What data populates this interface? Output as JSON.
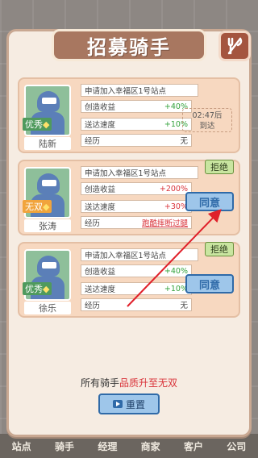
{
  "bottom_nav": [
    "站点",
    "骑手",
    "经理",
    "商家",
    "客户",
    "公司"
  ],
  "title": "招募骑手",
  "close_icon": "fork-knife-icon",
  "labels": {
    "profit": "创造收益",
    "speed": "送达速度",
    "experience": "经历"
  },
  "riders": [
    {
      "name": "陆新",
      "quality": "优秀",
      "apply": "申请加入幸福区1号站点",
      "profit": "+40%",
      "speed": "+10%",
      "experience": "无",
      "status": "02:47后\n到达"
    },
    {
      "name": "张涛",
      "quality": "无双",
      "apply": "申请加入幸福区1号站点",
      "profit": "+200%",
      "speed": "+30%",
      "experience": "跑酷摔断过腿",
      "agree": "同意",
      "reject": "拒绝"
    },
    {
      "name": "徐乐",
      "quality": "优秀",
      "apply": "申请加入幸福区1号站点",
      "profit": "+40%",
      "speed": "+10%",
      "experience": "无",
      "agree": "同意",
      "reject": "拒绝"
    }
  ],
  "footer": {
    "prefix": "所有骑手",
    "highlight": "品质升至无双"
  },
  "reset_label": "重置",
  "colors": {
    "panel_bg": "#f6ece2",
    "card_bg": "#f7d8c0",
    "title_bg": "#a87760",
    "agree_btn": "#9ec6ea",
    "reject_btn": "#c9e5a0",
    "arrow": "#e0202a"
  }
}
